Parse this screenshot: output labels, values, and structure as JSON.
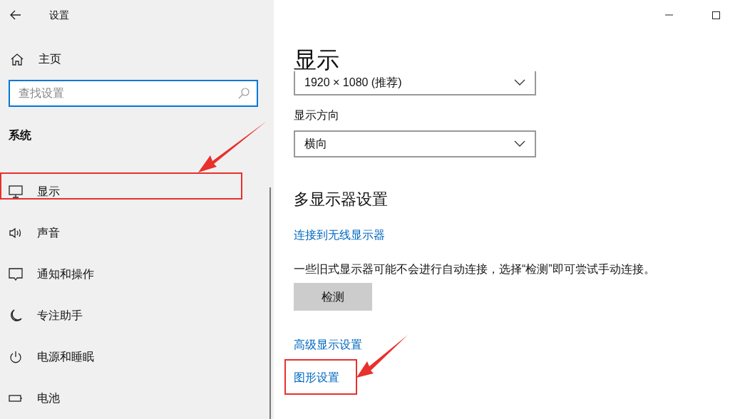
{
  "window": {
    "title": "设置"
  },
  "sidebar": {
    "home": "主页",
    "search": {
      "placeholder": "查找设置"
    },
    "section": "系统",
    "items": [
      {
        "label": "显示",
        "highlighted": true
      },
      {
        "label": "声音",
        "highlighted": false
      },
      {
        "label": "通知和操作",
        "highlighted": false
      },
      {
        "label": "专注助手",
        "highlighted": false
      },
      {
        "label": "电源和睡眠",
        "highlighted": false
      },
      {
        "label": "电池",
        "highlighted": false
      }
    ]
  },
  "content": {
    "title": "显示",
    "resolution": "1920 × 1080 (推荐)",
    "orientation_label": "显示方向",
    "orientation": "横向",
    "multi_heading": "多显示器设置",
    "wireless_link": "连接到无线显示器",
    "note": "一些旧式显示器可能不会进行自动连接，选择“检测”即可尝试手动连接。",
    "detect_button": "检测",
    "links": [
      {
        "label": "高级显示设置",
        "highlighted": false
      },
      {
        "label": "图形设置",
        "highlighted": true
      }
    ]
  }
}
